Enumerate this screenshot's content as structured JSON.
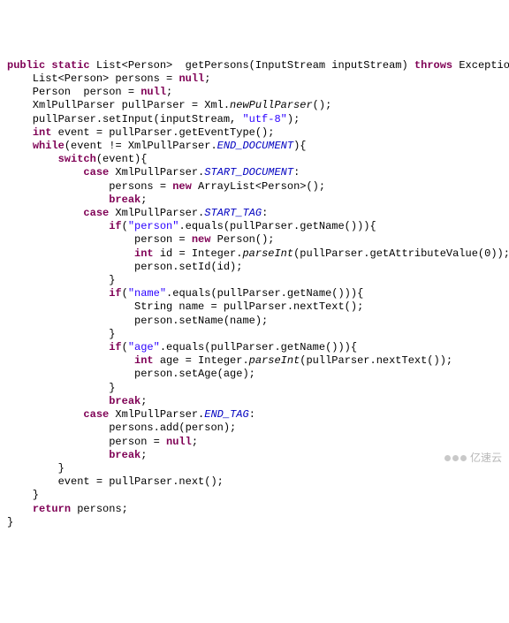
{
  "code": {
    "l1": {
      "kw1": "public",
      "kw2": "static",
      "ret": "List<Person> ",
      "fn": "getPersons(InputStream inputStream)",
      "kw3": "throws",
      "tail": " Exception{"
    },
    "l2": {
      "a": "    List<Person> persons = ",
      "kw": "null",
      "b": ";"
    },
    "l3": {
      "a": "    Person  person = ",
      "kw": "null",
      "b": ";"
    },
    "l4": {
      "a": "    XmlPullParser pullParser = Xml.",
      "m": "newPullParser",
      "b": "();"
    },
    "l5": {
      "a": "    pullParser.setInput(inputStream, ",
      "s": "\"utf-8\"",
      "b": ");"
    },
    "l6": {
      "a": "    ",
      "kw": "int",
      "b": " event = pullParser.getEventType();"
    },
    "l7": {
      "a": "    ",
      "kw": "while",
      "b": "(event != XmlPullParser.",
      "c": "END_DOCUMENT",
      "d": "){"
    },
    "l8": {
      "a": "        ",
      "kw": "switch",
      "b": "(event){"
    },
    "l9": {
      "a": "            ",
      "kw": "case",
      "b": " XmlPullParser.",
      "c": "START_DOCUMENT",
      "d": ":"
    },
    "l10": {
      "a": "                persons = ",
      "kw": "new",
      "b": " ArrayList<Person>();"
    },
    "l11": {
      "a": "                ",
      "kw": "break",
      "b": ";"
    },
    "l12": {
      "a": "            ",
      "kw": "case",
      "b": " XmlPullParser.",
      "c": "START_TAG",
      "d": ":"
    },
    "l13": {
      "a": "                ",
      "kw": "if",
      "b": "(",
      "s": "\"person\"",
      "c": ".equals(pullParser.getName())){"
    },
    "l14": {
      "a": "                    person = ",
      "kw": "new",
      "b": " Person();"
    },
    "l15": {
      "a": "                    ",
      "kw": "int",
      "b": " id = Integer.",
      "m": "parseInt",
      "c": "(pullParser.getAttributeValue(0));"
    },
    "l16": {
      "a": "                    person.setId(id);"
    },
    "l17": {
      "a": "                }"
    },
    "l18": {
      "a": "                ",
      "kw": "if",
      "b": "(",
      "s": "\"name\"",
      "c": ".equals(pullParser.getName())){"
    },
    "l19": {
      "a": "                    String name = pullParser.nextText();"
    },
    "l20": {
      "a": "                    person.setName(name);"
    },
    "l21": {
      "a": "                }"
    },
    "l22": {
      "a": "                ",
      "kw": "if",
      "b": "(",
      "s": "\"age\"",
      "c": ".equals(pullParser.getName())){"
    },
    "l23": {
      "a": "                    ",
      "kw": "int",
      "b": " age = Integer.",
      "m": "parseInt",
      "c": "(pullParser.nextText());"
    },
    "l24": {
      "a": "                    person.setAge(age);"
    },
    "l25": {
      "a": "                }"
    },
    "l26": {
      "a": "                ",
      "kw": "break",
      "b": ";"
    },
    "l27": {
      "a": "            ",
      "kw": "case",
      "b": " XmlPullParser.",
      "c": "END_TAG",
      "d": ":"
    },
    "l28": {
      "a": "                persons.add(person);"
    },
    "l29": {
      "a": "                person = ",
      "kw": "null",
      "b": ";"
    },
    "l30": {
      "a": "                ",
      "kw": "break",
      "b": ";"
    },
    "l31": {
      "a": "        }"
    },
    "l32": {
      "a": "        event = pullParser.next();"
    },
    "l33": {
      "a": "    }"
    },
    "l34": {
      "a": "    ",
      "kw": "return",
      "b": " persons;"
    },
    "l35": {
      "a": "}"
    }
  },
  "watermark": "亿速云"
}
